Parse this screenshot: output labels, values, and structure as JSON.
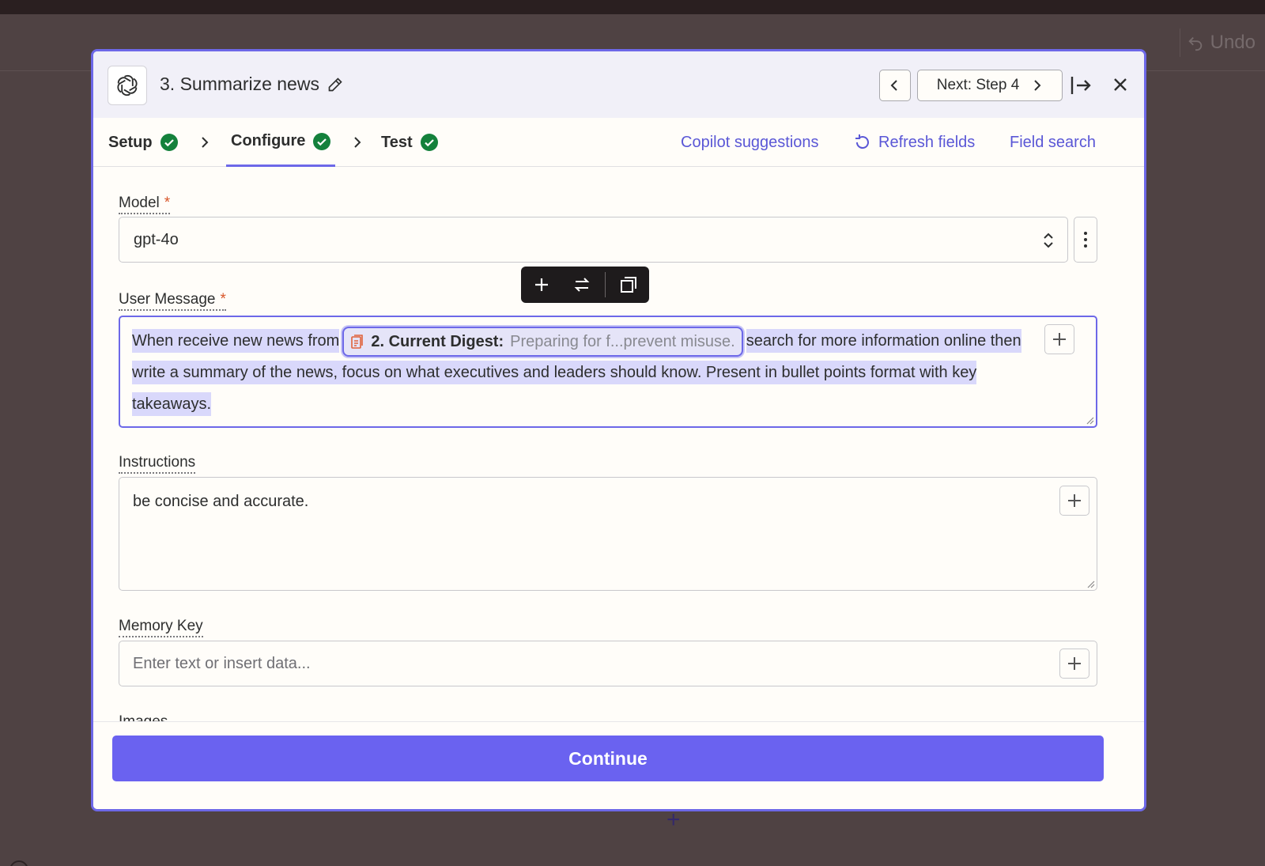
{
  "background": {
    "undo_label": "Undo"
  },
  "header": {
    "title": "3. Summarize news",
    "next_label": "Next: Step 4"
  },
  "tabs": [
    {
      "label": "Setup",
      "status": "complete"
    },
    {
      "label": "Configure",
      "status": "complete",
      "active": true
    },
    {
      "label": "Test",
      "status": "complete"
    }
  ],
  "links": {
    "copilot": "Copilot suggestions",
    "refresh": "Refresh fields",
    "field_search": "Field search"
  },
  "fields": {
    "model": {
      "label": "Model",
      "required": "*",
      "value": "gpt-4o"
    },
    "user_message": {
      "label": "User Message",
      "required": "*",
      "text_before": "When receive new news from",
      "pill_label": "2. Current Digest:",
      "pill_value": "Preparing for f...prevent misuse.",
      "text_after": "search for more information online then write a summary of the news, focus on what executives and leaders should know. Present in bullet points format with key takeaways."
    },
    "instructions": {
      "label": "Instructions",
      "value": "be concise and accurate."
    },
    "memory_key": {
      "label": "Memory Key",
      "placeholder": "Enter text or insert data..."
    },
    "images": {
      "label": "Images"
    }
  },
  "footer": {
    "continue_label": "Continue"
  },
  "colors": {
    "accent": "#6d68e8",
    "button": "#6a62f0",
    "link": "#5a57d6",
    "success": "#14813c",
    "required": "#d8562a"
  }
}
